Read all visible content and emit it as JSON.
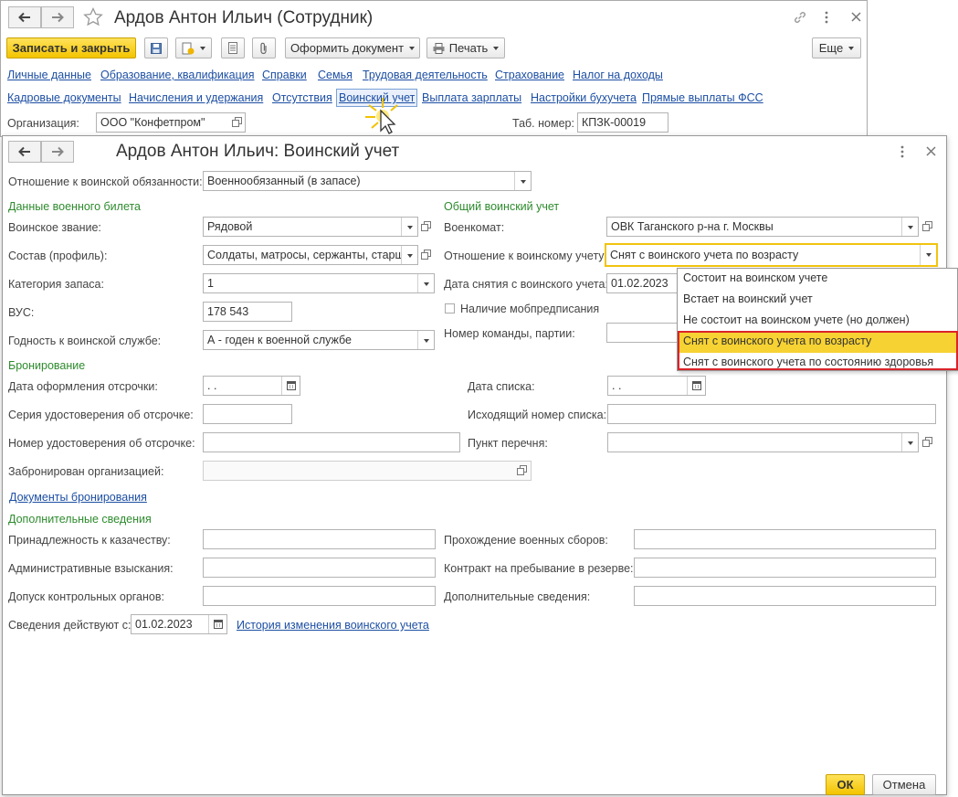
{
  "back_window": {
    "title": "Ардов Антон Ильич (Сотрудник)",
    "toolbar": {
      "save_close": "Записать и закрыть",
      "create_document": "Оформить документ",
      "print": "Печать",
      "more": "Еще"
    },
    "nav_row1": [
      "Личные данные",
      "Образование, квалификация",
      "Справки",
      "Семья",
      "Трудовая деятельность",
      "Страхование",
      "Налог на доходы"
    ],
    "nav_row2": [
      "Кадровые документы",
      "Начисления и удержания",
      "Отсутствия",
      "Воинский учет",
      "Выплата зарплаты",
      "Настройки бухучета",
      "Прямые выплаты ФСС"
    ],
    "org_label": "Организация:",
    "org_value": "ООО \"Конфетпром\"",
    "tab_label": "Таб. номер:",
    "tab_value": "КПЗК-00019"
  },
  "form": {
    "title": "Ардов Антон Ильич: Воинский учет",
    "duty_label": "Отношение к воинской обязанности:",
    "duty_value": "Военнообязанный (в запасе)",
    "military_id_section": "Данные военного билета",
    "rank_label": "Воинское звание:",
    "rank_value": "Рядовой",
    "composition_label": "Состав (профиль):",
    "composition_value": "Солдаты, матросы, сержанты, старши",
    "reserve_cat_label": "Категория запаса:",
    "reserve_cat_value": "1",
    "vus_label": "ВУС:",
    "vus_value": "178 543",
    "fitness_label": "Годность к воинской службе:",
    "fitness_value": "А - годен к военной службе",
    "general_section": "Общий воинский учет",
    "commissariat_label": "Военкомат:",
    "commissariat_value": "ОВК Таганского р-на г. Москвы",
    "relation_label": "Отношение к воинскому учету:",
    "relation_value": "Снят с воинского учета по возрасту",
    "removal_date_label": "Дата снятия с воинского учета:",
    "removal_date_value": "01.02.2023",
    "mob_label": "Наличие мобпредписания",
    "team_label": "Номер команды, партии:",
    "reservation_section": "Бронирование",
    "deferral_date_label": "Дата оформления отсрочки:",
    "deferral_date_value": " .  .",
    "deferral_series_label": "Серия удостоверения об отсрочке:",
    "deferral_number_label": "Номер удостоверения об отсрочке:",
    "reserved_by_label": "Забронирован организацией:",
    "list_date_label": "Дата списка:",
    "list_date_value": " .  .",
    "outgoing_number_label": "Исходящий номер списка:",
    "list_item_label": "Пункт перечня:",
    "reservation_docs_link": "Документы бронирования",
    "additional_section": "Дополнительные сведения",
    "cossack_label": "Принадлежность к казачеству:",
    "admin_penalties_label": "Административные взыскания:",
    "control_access_label": "Допуск контрольных органов:",
    "training_label": "Прохождение военных сборов:",
    "reserve_contract_label": "Контракт на пребывание в резерве:",
    "additional_info_label": "Дополнительные сведения:",
    "effective_label": "Сведения действуют с:",
    "effective_value": "01.02.2023",
    "history_link": "История изменения воинского учета",
    "ok": "ОК",
    "cancel": "Отмена"
  },
  "dropdown_options": [
    "Состоит на воинском учете",
    "Встает на воинский учет",
    "Не состоит на воинском учете (но должен)",
    "Снят с воинского учета по возрасту",
    "Снят с воинского учета по состоянию здоровья"
  ],
  "selected_option_index": 3,
  "colors": {
    "accent_yellow": "#f7d233",
    "link_blue": "#1d4fa3",
    "section_green": "#2e8b2e",
    "highlight_red": "#d9242a"
  }
}
